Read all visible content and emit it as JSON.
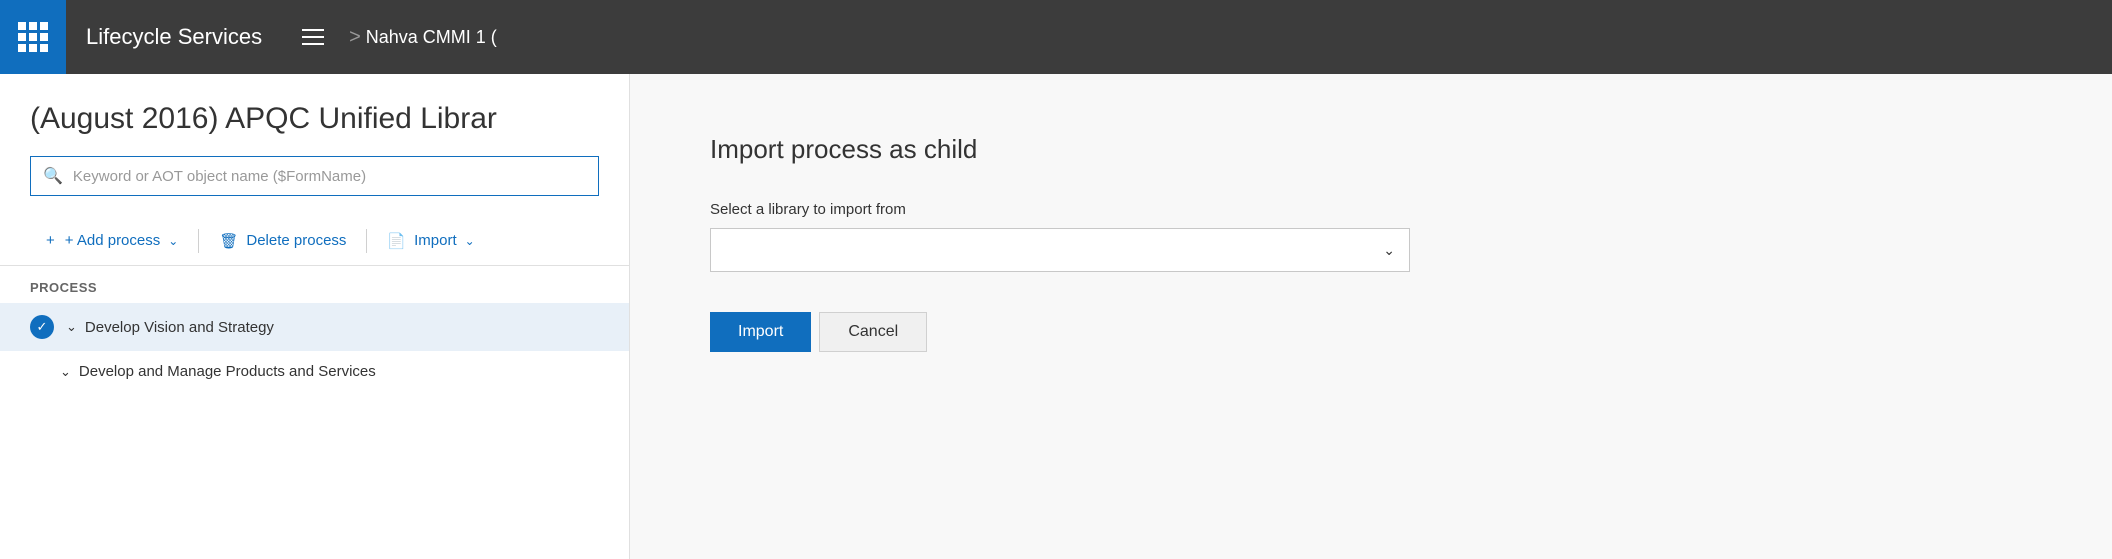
{
  "header": {
    "app_title": "Lifecycle Services",
    "breadcrumb_separator": ">",
    "breadcrumb_project": "Nahva CMMI 1 ("
  },
  "page": {
    "title": "(August 2016) APQC Unified Librar"
  },
  "search": {
    "placeholder": "Keyword or AOT object name ($FormName)"
  },
  "toolbar": {
    "add_process": "+ Add process",
    "delete_process": "Delete process",
    "import": "Import",
    "add_chevron": "∨",
    "import_chevron": "∨"
  },
  "process_list": {
    "section_label": "Process",
    "items": [
      {
        "label": "Develop Vision and Strategy",
        "selected": true,
        "has_check": true,
        "indent": false
      },
      {
        "label": "Develop and Manage Products and Services",
        "selected": false,
        "has_check": false,
        "indent": true
      }
    ]
  },
  "dialog": {
    "title": "Import process as child",
    "select_label": "Select a library to import from",
    "select_placeholder": "",
    "import_btn": "Import",
    "cancel_btn": "Cancel"
  },
  "icons": {
    "search": "🔍",
    "add": "+",
    "delete": "🗑",
    "import_doc": "📄",
    "checkmark": "✓",
    "chevron_down": "∨",
    "chevron_right": "›"
  }
}
